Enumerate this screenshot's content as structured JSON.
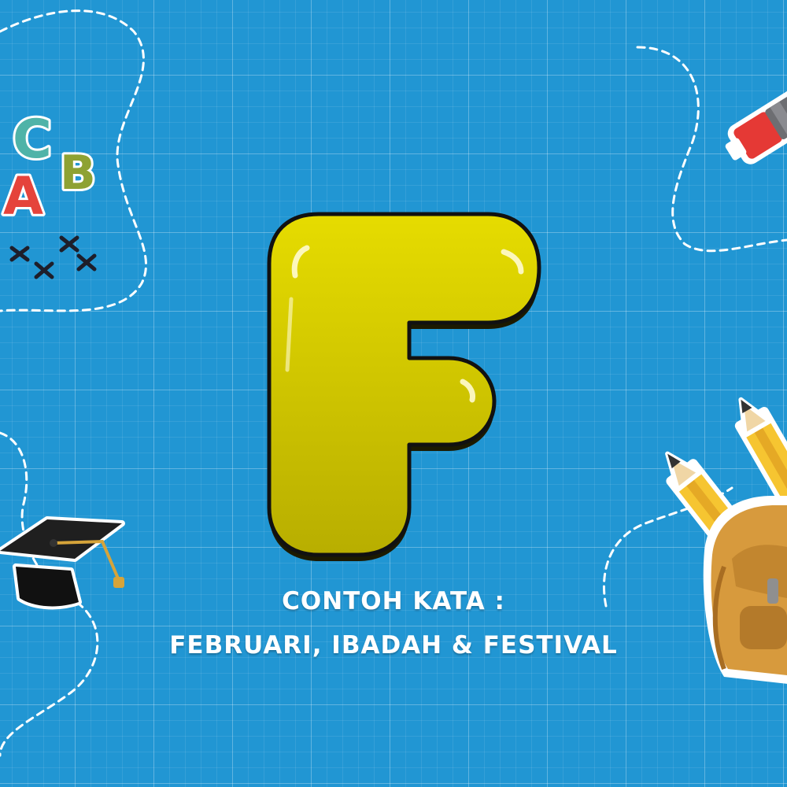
{
  "featured_letter": "F",
  "caption": {
    "line1": "CONTOH KATA :",
    "line2": "FEBRUARI, IBADAH & FESTIVAL"
  },
  "decorations": {
    "abc_letters": [
      "A",
      "B",
      "C"
    ],
    "icons": [
      "abc-blocks-icon",
      "graduation-cap-icon",
      "marker-pen-icon",
      "pencils-icon",
      "backpack-icon",
      "cross-marks-icon"
    ]
  },
  "colors": {
    "background": "#2196d3",
    "letter_fill": "#d6cd00",
    "outline": "#111111",
    "text": "#ffffff"
  }
}
